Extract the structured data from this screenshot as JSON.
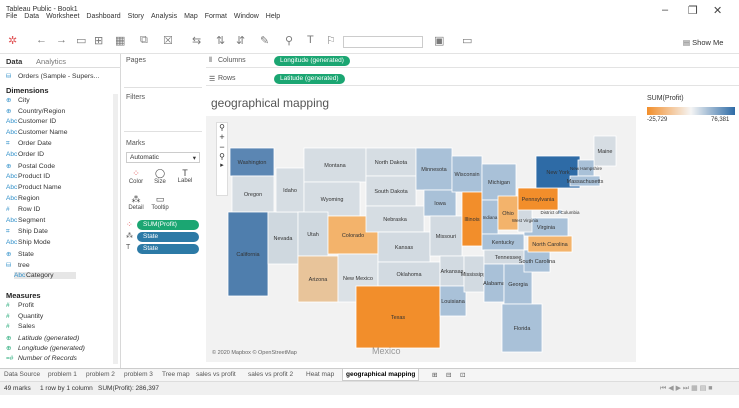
{
  "window": {
    "title": "Tableau Public - Book1",
    "minimize": "–",
    "restore": "❐",
    "close": "✕"
  },
  "menu": [
    "File",
    "Data",
    "Worksheet",
    "Dashboard",
    "Story",
    "Analysis",
    "Map",
    "Format",
    "Window",
    "Help"
  ],
  "toolbar": {
    "show_me": "Show Me"
  },
  "data_panel": {
    "tab_data": "Data",
    "tab_analytics": "Analytics",
    "source": "Orders (Sample - Supers...",
    "dimensions_label": "Dimensions",
    "dimensions": [
      {
        "icon": "⊕",
        "name": "City"
      },
      {
        "icon": "⊕",
        "name": "Country/Region"
      },
      {
        "icon": "Abc",
        "name": "Customer ID"
      },
      {
        "icon": "Abc",
        "name": "Customer Name"
      },
      {
        "icon": "⌗",
        "name": "Order Date"
      },
      {
        "icon": "Abc",
        "name": "Order ID"
      },
      {
        "icon": "⊕",
        "name": "Postal Code"
      },
      {
        "icon": "Abc",
        "name": "Product ID"
      },
      {
        "icon": "Abc",
        "name": "Product Name"
      },
      {
        "icon": "Abc",
        "name": "Region"
      },
      {
        "icon": "#",
        "name": "Row ID"
      },
      {
        "icon": "Abc",
        "name": "Segment"
      },
      {
        "icon": "⌗",
        "name": "Ship Date"
      },
      {
        "icon": "Abc",
        "name": "Ship Mode"
      },
      {
        "icon": "⊕",
        "name": "State"
      },
      {
        "icon": "⛁",
        "name": "tree"
      },
      {
        "icon": "Abc",
        "name": "Category"
      }
    ],
    "measures_label": "Measures",
    "measures": [
      {
        "icon": "#",
        "name": "Profit"
      },
      {
        "icon": "#",
        "name": "Quantity"
      },
      {
        "icon": "#",
        "name": "Sales"
      },
      {
        "icon": "⊕",
        "name": "Latitude (generated)"
      },
      {
        "icon": "⊕",
        "name": "Longitude (generated)"
      },
      {
        "icon": "=#",
        "name": "Number of Records"
      }
    ]
  },
  "shelves": {
    "pages": "Pages",
    "filters": "Filters",
    "marks": "Marks",
    "mark_type": "Automatic",
    "color": "Color",
    "size": "Size",
    "label": "Label",
    "detail": "Detail",
    "tooltip": "Tooltip",
    "mark_pills": [
      "SUM(Profit)",
      "State",
      "State"
    ],
    "columns_label": "Columns",
    "columns_pill": "Longitude (generated)",
    "rows_label": "Rows",
    "rows_pill": "Latitude (generated)"
  },
  "viz": {
    "title": "geographical mapping",
    "attribution": "© 2020 Mapbox © OpenStreetMap",
    "mexico": "Mexico",
    "states": [
      {
        "name": "Washington"
      },
      {
        "name": "Oregon"
      },
      {
        "name": "California"
      },
      {
        "name": "Nevada"
      },
      {
        "name": "Idaho"
      },
      {
        "name": "Montana"
      },
      {
        "name": "Wyoming"
      },
      {
        "name": "Utah"
      },
      {
        "name": "Arizona"
      },
      {
        "name": "Colorado"
      },
      {
        "name": "New Mexico"
      },
      {
        "name": "North Dakota"
      },
      {
        "name": "South Dakota"
      },
      {
        "name": "Nebraska"
      },
      {
        "name": "Kansas"
      },
      {
        "name": "Oklahoma"
      },
      {
        "name": "Texas"
      },
      {
        "name": "Minnesota"
      },
      {
        "name": "Iowa"
      },
      {
        "name": "Missouri"
      },
      {
        "name": "Arkansas"
      },
      {
        "name": "Louisiana"
      },
      {
        "name": "Wisconsin"
      },
      {
        "name": "Illinois"
      },
      {
        "name": "Mississippi"
      },
      {
        "name": "Michigan"
      },
      {
        "name": "Indiana"
      },
      {
        "name": "Kentucky"
      },
      {
        "name": "Tennessee"
      },
      {
        "name": "Alabama"
      },
      {
        "name": "Ohio"
      },
      {
        "name": "Georgia"
      },
      {
        "name": "Florida"
      },
      {
        "name": "South Carolina"
      },
      {
        "name": "North Carolina"
      },
      {
        "name": "Virginia"
      },
      {
        "name": "West Virginia"
      },
      {
        "name": "Pennsylvania"
      },
      {
        "name": "New York"
      },
      {
        "name": "Maine"
      },
      {
        "name": "New Hampshire"
      },
      {
        "name": "Massachusetts"
      },
      {
        "name": "District of Columbia"
      }
    ]
  },
  "legend": {
    "title": "SUM(Profit)",
    "min": "-25,729",
    "max": "76,381",
    "color_low": "#f28e2b",
    "color_high": "#2e6ba6"
  },
  "sheet_tabs": [
    "Data Source",
    "problem 1",
    "problem 2",
    "problem 3",
    "Tree map",
    "sales vs profit",
    "sales vs profit 2",
    "Heat map",
    "geographical mapping"
  ],
  "active_tab": "geographical mapping",
  "status": {
    "marks": "49 marks",
    "rows": "1 row by 1 column",
    "sum": "SUM(Profit): 286,397"
  }
}
